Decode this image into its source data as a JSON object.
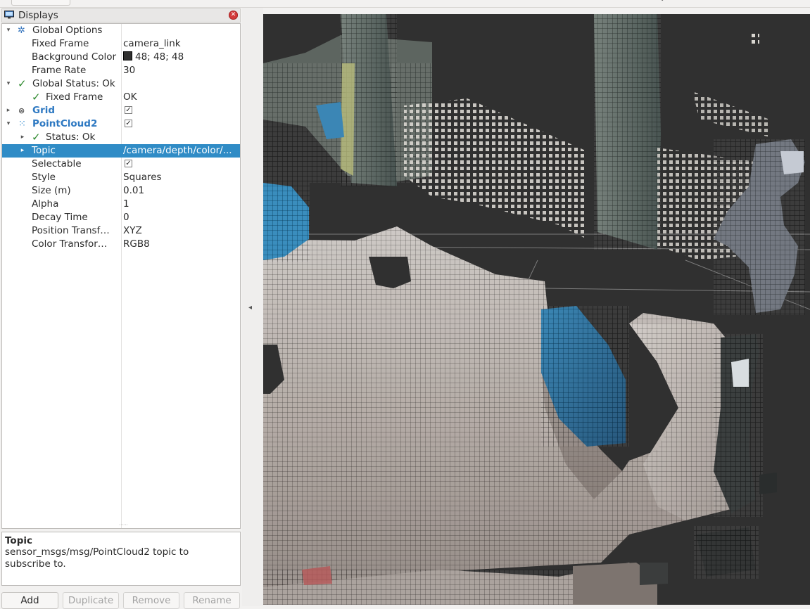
{
  "panel": {
    "title": "Displays",
    "monitor_icon": "monitor-icon",
    "close_icon": "close-icon"
  },
  "tree": [
    {
      "label": "Global Options",
      "indent": 0,
      "expander": "open",
      "icon": "gear-icon"
    },
    {
      "label": "Fixed Frame",
      "value": "camera_link",
      "indent": 1
    },
    {
      "label": "Background Color",
      "value": "48; 48; 48",
      "indent": 1,
      "swatch": "#303030"
    },
    {
      "label": "Frame Rate",
      "value": "30",
      "indent": 1
    },
    {
      "label": "Global Status: Ok",
      "indent": 0,
      "expander": "open",
      "icon": "checkmark-icon"
    },
    {
      "label": "Fixed Frame",
      "value": "OK",
      "indent": 1,
      "icon": "checkmark-icon"
    },
    {
      "label": "Grid",
      "indent": 0,
      "expander": "closed",
      "icon": "grid-icon",
      "checked": true
    },
    {
      "label": "PointCloud2",
      "indent": 0,
      "expander": "open",
      "icon": "pointcloud-icon",
      "checked": true
    },
    {
      "label": "Status: Ok",
      "indent": 1,
      "expander": "closed",
      "icon": "checkmark-icon"
    },
    {
      "label": "Topic",
      "value": "/camera/depth/color/...",
      "indent": 1,
      "expander": "closed",
      "selected": true
    },
    {
      "label": "Selectable",
      "indent": 1,
      "checked": true
    },
    {
      "label": "Style",
      "value": "Squares",
      "indent": 1
    },
    {
      "label": "Size (m)",
      "value": "0.01",
      "indent": 1
    },
    {
      "label": "Alpha",
      "value": "1",
      "indent": 1
    },
    {
      "label": "Decay Time",
      "value": "0",
      "indent": 1
    },
    {
      "label": "Position Transf…",
      "value": "XYZ",
      "indent": 1
    },
    {
      "label": "Color Transfor…",
      "value": "RGB8",
      "indent": 1
    }
  ],
  "description": {
    "title": "Topic",
    "text": "sensor_msgs/msg/PointCloud2 topic to subscribe to."
  },
  "buttons": {
    "add": "Add",
    "duplicate": "Duplicate",
    "remove": "Remove",
    "rename": "Rename"
  },
  "view": {
    "background": "#303030",
    "content": "3D point cloud render"
  },
  "colors": {
    "selection": "#308cc6",
    "accent_blue": "#2e79c2",
    "ok_green": "#2f8a2f"
  }
}
